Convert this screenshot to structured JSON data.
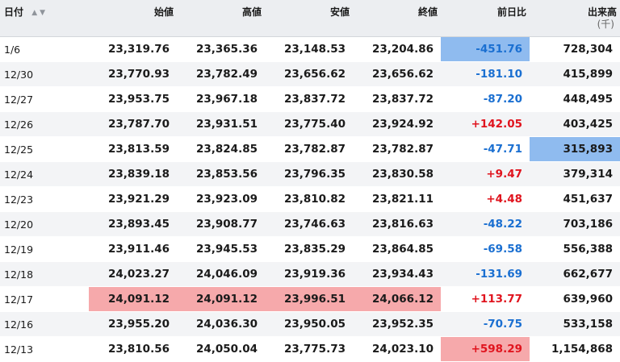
{
  "headers": {
    "date": "日付",
    "sort_icons": "▲▼",
    "open": "始値",
    "high": "高値",
    "low": "安値",
    "close": "終値",
    "change": "前日比",
    "volume": "出来高",
    "volume_unit": "(千)"
  },
  "highlight_colors": {
    "red": "#f6a9ab",
    "blue": "#8fbbef"
  },
  "rows": [
    {
      "date": "1/6",
      "open": "23,319.76",
      "high": "23,365.36",
      "low": "23,148.53",
      "close": "23,204.86",
      "change": "-451.76",
      "volume": "728,304",
      "hl": {
        "change": "blue"
      }
    },
    {
      "date": "12/30",
      "open": "23,770.93",
      "high": "23,782.49",
      "low": "23,656.62",
      "close": "23,656.62",
      "change": "-181.10",
      "volume": "415,899",
      "hl": {}
    },
    {
      "date": "12/27",
      "open": "23,953.75",
      "high": "23,967.18",
      "low": "23,837.72",
      "close": "23,837.72",
      "change": "-87.20",
      "volume": "448,495",
      "hl": {}
    },
    {
      "date": "12/26",
      "open": "23,787.70",
      "high": "23,931.51",
      "low": "23,775.40",
      "close": "23,924.92",
      "change": "+142.05",
      "volume": "403,425",
      "hl": {}
    },
    {
      "date": "12/25",
      "open": "23,813.59",
      "high": "23,824.85",
      "low": "23,782.87",
      "close": "23,782.87",
      "change": "-47.71",
      "volume": "315,893",
      "hl": {
        "volume": "blue"
      }
    },
    {
      "date": "12/24",
      "open": "23,839.18",
      "high": "23,853.56",
      "low": "23,796.35",
      "close": "23,830.58",
      "change": "+9.47",
      "volume": "379,314",
      "hl": {}
    },
    {
      "date": "12/23",
      "open": "23,921.29",
      "high": "23,923.09",
      "low": "23,810.82",
      "close": "23,821.11",
      "change": "+4.48",
      "volume": "451,637",
      "hl": {}
    },
    {
      "date": "12/20",
      "open": "23,893.45",
      "high": "23,908.77",
      "low": "23,746.63",
      "close": "23,816.63",
      "change": "-48.22",
      "volume": "703,186",
      "hl": {}
    },
    {
      "date": "12/19",
      "open": "23,911.46",
      "high": "23,945.53",
      "low": "23,835.29",
      "close": "23,864.85",
      "change": "-69.58",
      "volume": "556,388",
      "hl": {}
    },
    {
      "date": "12/18",
      "open": "24,023.27",
      "high": "24,046.09",
      "low": "23,919.36",
      "close": "23,934.43",
      "change": "-131.69",
      "volume": "662,677",
      "hl": {}
    },
    {
      "date": "12/17",
      "open": "24,091.12",
      "high": "24,091.12",
      "low": "23,996.51",
      "close": "24,066.12",
      "change": "+113.77",
      "volume": "639,960",
      "hl": {
        "open": "red",
        "high": "red",
        "low": "red",
        "close": "red"
      }
    },
    {
      "date": "12/16",
      "open": "23,955.20",
      "high": "24,036.30",
      "low": "23,950.05",
      "close": "23,952.35",
      "change": "-70.75",
      "volume": "533,158",
      "hl": {}
    },
    {
      "date": "12/13",
      "open": "23,810.56",
      "high": "24,050.04",
      "low": "23,775.73",
      "close": "24,023.10",
      "change": "+598.29",
      "volume": "1,154,868",
      "hl": {
        "change": "red"
      }
    }
  ]
}
